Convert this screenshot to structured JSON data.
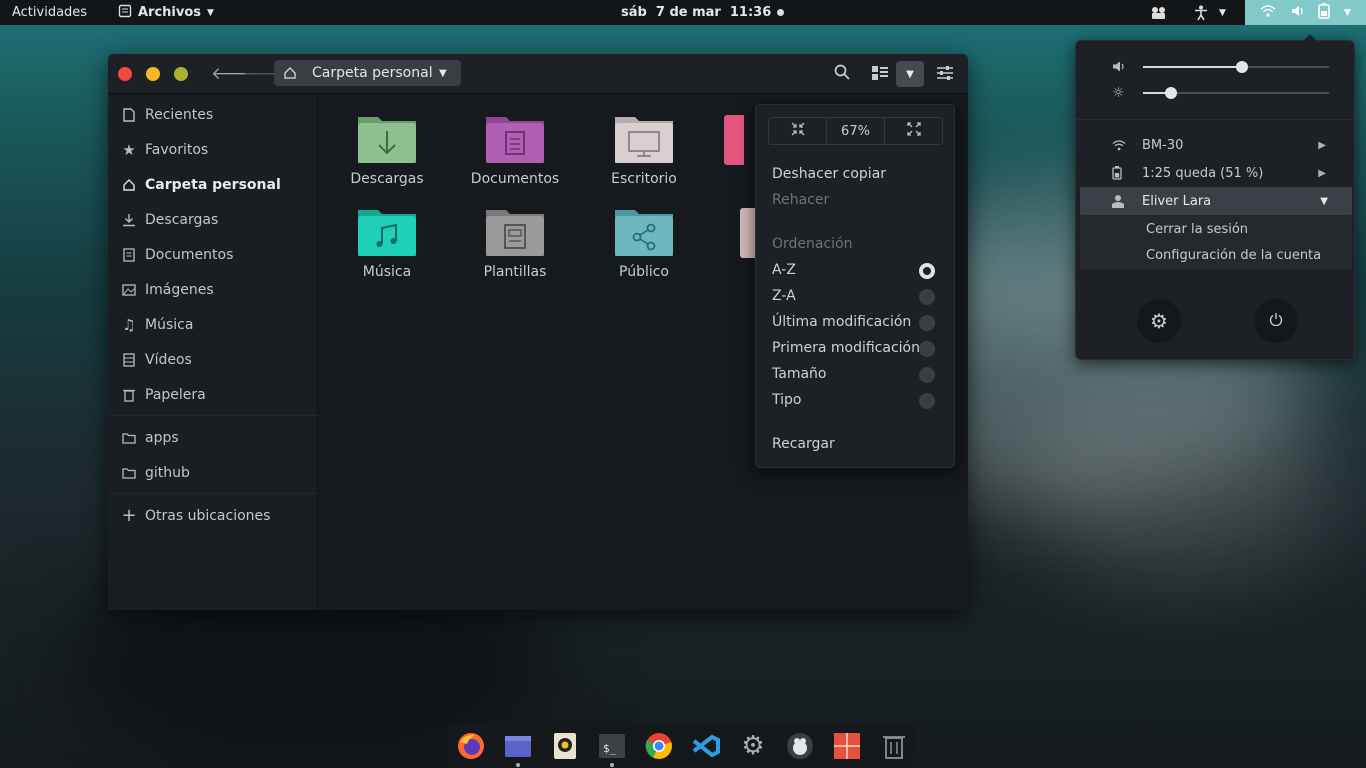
{
  "topbar": {
    "activities": "Actividades",
    "app_menu": "Archivos",
    "clock": "sáb  7 de mar  11:36"
  },
  "window": {
    "path": "Carpeta personal"
  },
  "sidebar": {
    "items": [
      {
        "label": "Recientes",
        "icon": "clock-icon"
      },
      {
        "label": "Favoritos",
        "icon": "star-icon"
      },
      {
        "label": "Carpeta personal",
        "icon": "home-icon",
        "active": true
      },
      {
        "label": "Descargas",
        "icon": "download-icon"
      },
      {
        "label": "Documentos",
        "icon": "document-icon"
      },
      {
        "label": "Imágenes",
        "icon": "image-icon"
      },
      {
        "label": "Música",
        "icon": "music-icon"
      },
      {
        "label": "Vídeos",
        "icon": "video-icon"
      },
      {
        "label": "Papelera",
        "icon": "trash-icon"
      },
      {
        "label": "apps",
        "icon": "folder-icon"
      },
      {
        "label": "github",
        "icon": "folder-icon"
      },
      {
        "label": "Otras ubicaciones",
        "icon": "plus-icon"
      }
    ]
  },
  "files": [
    {
      "label": "Descargas",
      "color": "#8fbf8f"
    },
    {
      "label": "Documentos",
      "color": "#b05fb5"
    },
    {
      "label": "Escritorio",
      "color": "#d8cfd0"
    },
    {
      "label": "Música",
      "color": "#1fcfb8"
    },
    {
      "label": "Plantillas",
      "color": "#9a9a9a"
    },
    {
      "label": "Público",
      "color": "#6fb7bf"
    }
  ],
  "view_menu": {
    "zoom": "67%",
    "undo": "Deshacer copiar",
    "redo": "Rehacer",
    "sort_header": "Ordenación",
    "sort_options": [
      "A-Z",
      "Z-A",
      "Última modificación",
      "Primera modificación",
      "Tamaño",
      "Tipo"
    ],
    "sort_selected": "A-Z",
    "reload": "Recargar"
  },
  "system_menu": {
    "volume": 0.53,
    "brightness": 0.15,
    "wifi": "BM-30",
    "battery": "1:25 queda (51 %)",
    "user": "Eliver Lara",
    "logout": "Cerrar la sesión",
    "account": "Configuración de la cuenta"
  },
  "dock": {
    "apps": [
      "firefox-icon",
      "files-icon",
      "rhythmbox-icon",
      "terminal-icon",
      "chrome-icon",
      "vscode-icon",
      "settings-icon",
      "gimp-icon",
      "mosaic-icon",
      "trash-icon"
    ]
  }
}
